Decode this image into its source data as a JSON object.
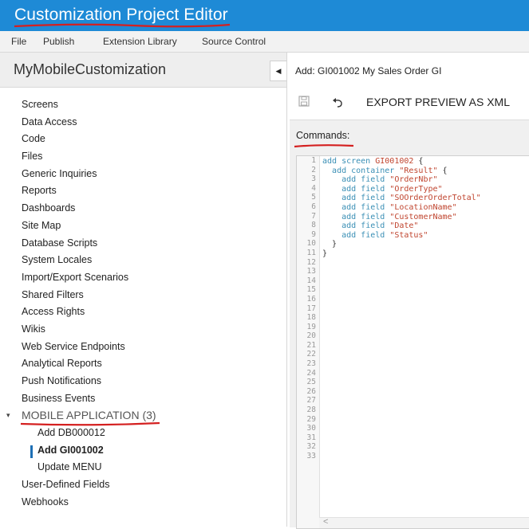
{
  "app": {
    "title": "Customization Project Editor"
  },
  "menu": [
    "File",
    "Publish",
    "Extension Library",
    "Source Control"
  ],
  "sidebar": {
    "project_name": "MyMobileCustomization",
    "items_before": [
      "Screens",
      "Data Access",
      "Code",
      "Files",
      "Generic Inquiries",
      "Reports",
      "Dashboards",
      "Site Map",
      "Database Scripts",
      "System Locales",
      "Import/Export Scenarios",
      "Shared Filters",
      "Access Rights",
      "Wikis",
      "Web Service Endpoints",
      "Analytical Reports",
      "Push Notifications",
      "Business Events"
    ],
    "group": {
      "label": "MOBILE APPLICATION (3)",
      "expanded": true
    },
    "group_items": [
      {
        "label": "Add DB000012",
        "active": false
      },
      {
        "label": "Add GI001002",
        "active": true
      },
      {
        "label": "Update MENU",
        "active": false
      }
    ],
    "items_after": [
      "User-Defined Fields",
      "Webhooks"
    ]
  },
  "main": {
    "breadcrumb": "Add: GI001002 My Sales Order GI",
    "toolbar": {
      "save_icon": "save-icon",
      "undo_icon": "undo-icon",
      "export_label": "EXPORT PREVIEW AS XML"
    },
    "commands_label": "Commands:",
    "line_count": 33,
    "code_lines": [
      [
        {
          "t": "kw",
          "v": "add screen "
        },
        {
          "t": "str",
          "v": "GI001002"
        },
        {
          "t": "pl",
          "v": " {"
        }
      ],
      [
        {
          "t": "pl",
          "v": "  "
        },
        {
          "t": "kw",
          "v": "add container "
        },
        {
          "t": "str",
          "v": "\"Result\""
        },
        {
          "t": "pl",
          "v": " {"
        }
      ],
      [
        {
          "t": "pl",
          "v": "    "
        },
        {
          "t": "kw",
          "v": "add field "
        },
        {
          "t": "str",
          "v": "\"OrderNbr\""
        }
      ],
      [
        {
          "t": "pl",
          "v": "    "
        },
        {
          "t": "kw",
          "v": "add field "
        },
        {
          "t": "str",
          "v": "\"OrderType\""
        }
      ],
      [
        {
          "t": "pl",
          "v": "    "
        },
        {
          "t": "kw",
          "v": "add field "
        },
        {
          "t": "str",
          "v": "\"SOOrderOrderTotal\""
        }
      ],
      [
        {
          "t": "pl",
          "v": "    "
        },
        {
          "t": "kw",
          "v": "add field "
        },
        {
          "t": "str",
          "v": "\"LocationName\""
        }
      ],
      [
        {
          "t": "pl",
          "v": "    "
        },
        {
          "t": "kw",
          "v": "add field "
        },
        {
          "t": "str",
          "v": "\"CustomerName\""
        }
      ],
      [
        {
          "t": "pl",
          "v": "    "
        },
        {
          "t": "kw",
          "v": "add field "
        },
        {
          "t": "str",
          "v": "\"Date\""
        }
      ],
      [
        {
          "t": "pl",
          "v": "    "
        },
        {
          "t": "kw",
          "v": "add field "
        },
        {
          "t": "str",
          "v": "\"Status\""
        }
      ],
      [
        {
          "t": "pl",
          "v": "  }"
        }
      ],
      [
        {
          "t": "pl",
          "v": "}"
        }
      ]
    ]
  },
  "colors": {
    "titlebar": "#1e8ad6",
    "annotation": "#d42020",
    "keyword": "#3a8fb5",
    "string": "#c0452f"
  }
}
